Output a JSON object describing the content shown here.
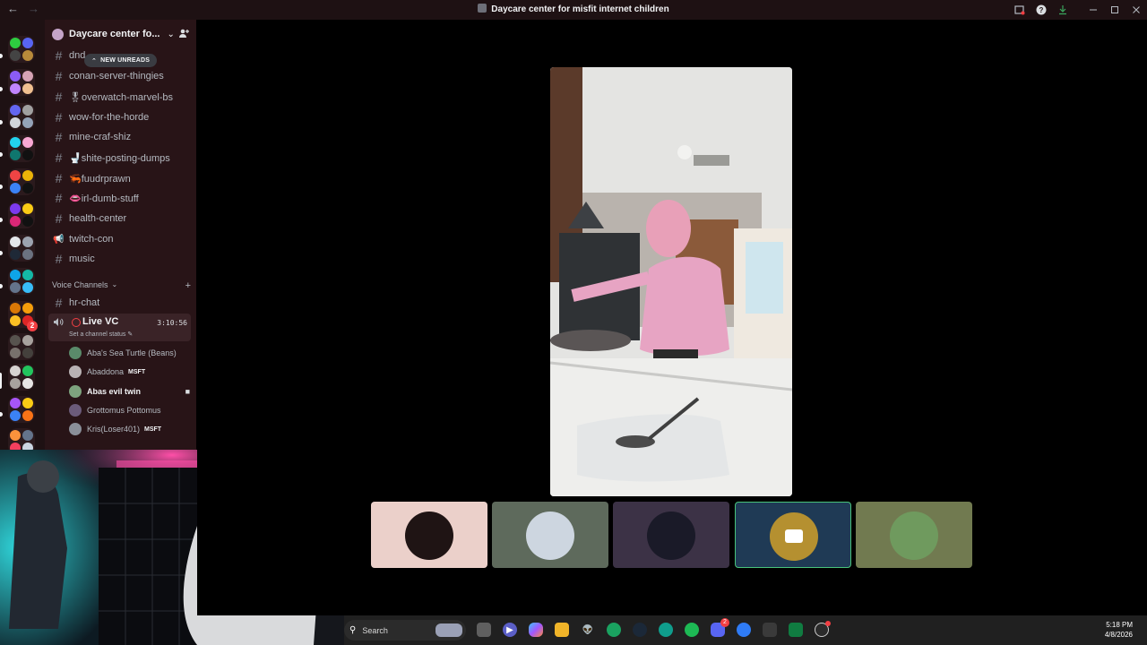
{
  "window": {
    "title": "Daycare center for misfit internet children",
    "back_glyph": "←",
    "forward_glyph": "→"
  },
  "server": {
    "name": "Daycare center fo...",
    "new_unreads_label": "NEW UNREADS"
  },
  "channels": [
    {
      "name": "dnd",
      "icon": "hash-icon"
    },
    {
      "name": "conan-server-thingies",
      "icon": "hash-icon"
    },
    {
      "name": "🎖overwatch-marvel-bs",
      "icon": "hash-icon"
    },
    {
      "name": "wow-for-the-horde",
      "icon": "hash-icon"
    },
    {
      "name": "mine-craf-shiz",
      "icon": "hash-icon"
    },
    {
      "name": "🚽shite-posting-dumps",
      "icon": "hash-icon"
    },
    {
      "name": "🦐fuudrprawn",
      "icon": "hash-icon"
    },
    {
      "name": "👄irl-dumb-stuff",
      "icon": "hash-icon"
    },
    {
      "name": "health-center",
      "icon": "hash-icon"
    },
    {
      "name": "twitch-con",
      "icon": "megaphone-icon"
    },
    {
      "name": "music",
      "icon": "hash-icon"
    }
  ],
  "voice_category": "Voice Channels",
  "hr_chat": "hr-chat",
  "live_vc": {
    "name": "Live VC",
    "timer": "3:10:56",
    "status": "Set a channel status"
  },
  "voice_users": [
    {
      "name": "Aba's Sea Turtle (Beans)",
      "tag": "",
      "bold": false,
      "color": "#5a8a6a"
    },
    {
      "name": "Abaddona",
      "tag": "MSFT",
      "bold": false,
      "color": "#b9b2b4"
    },
    {
      "name": "Abas evil twin",
      "tag": "",
      "bold": true,
      "color": "#7ea37e"
    },
    {
      "name": "Grottomus Pottomus",
      "tag": "",
      "bold": false,
      "color": "#6b5b7a"
    },
    {
      "name": "Kris(Loser401)",
      "tag": "MSFT",
      "bold": false,
      "color": "#8a8f99"
    }
  ],
  "tiles": [
    {
      "bg": "#ebd0ca",
      "avatar": "#1f1414"
    },
    {
      "bg": "#5e6a5c",
      "avatar": "#cdd6e0"
    },
    {
      "bg": "#3c3246",
      "avatar": "#1a1a28"
    },
    {
      "bg": "#1f3a55",
      "avatar": "#b59030"
    },
    {
      "bg": "#717a50",
      "avatar": "#6f9a5e"
    }
  ],
  "taskbar": {
    "search_label": "Search",
    "time": "5:18 PM",
    "date": "4/8/2026",
    "discord_badge": "2"
  },
  "colors": {
    "accent_red": "#f23f43",
    "sidebar_bg": "#281417",
    "selected_tile_border": "#48c37a"
  }
}
